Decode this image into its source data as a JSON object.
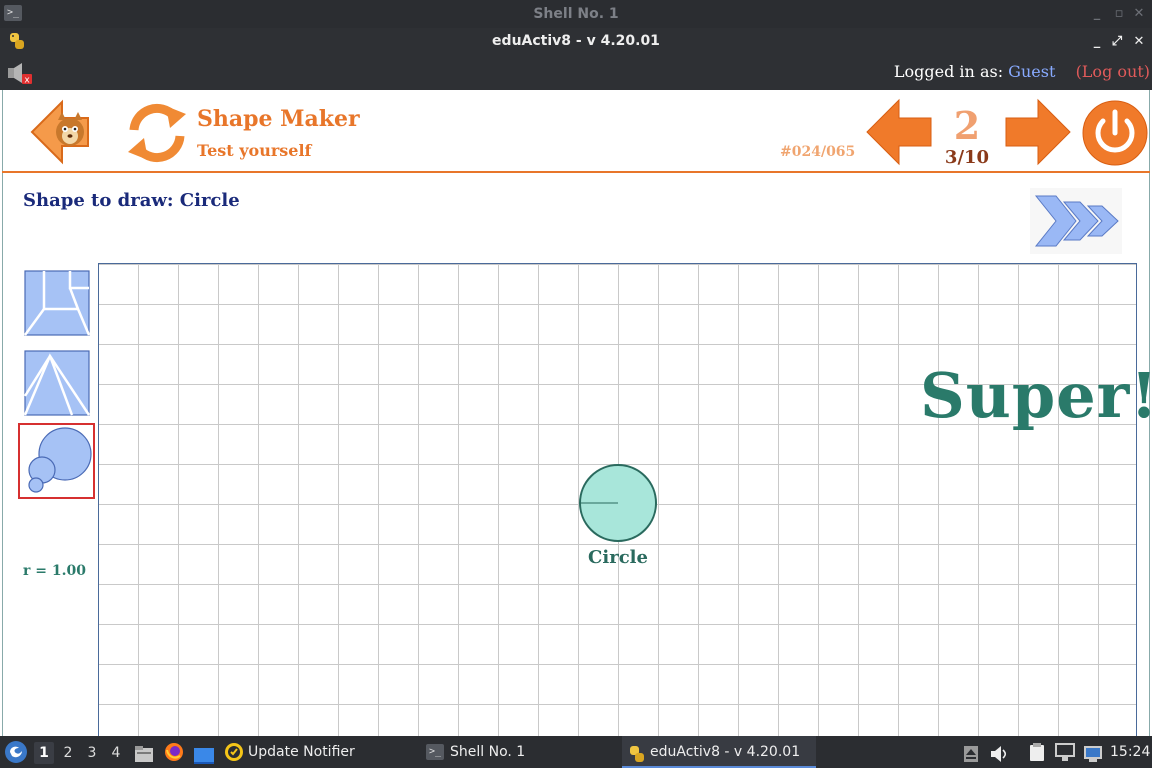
{
  "shell_window": {
    "title": "Shell No. 1"
  },
  "app_window": {
    "title": "eduActiv8 - v 4.20.01"
  },
  "login": {
    "prefix": "Logged in as:",
    "user": "Guest",
    "logout": "(Log out)"
  },
  "header": {
    "title": "Shape Maker",
    "subtitle": "Test yourself",
    "activity_id": "#024/065",
    "level": "2",
    "progress": "3/10"
  },
  "task": {
    "prompt": "Shape to draw: Circle"
  },
  "sidebar": {
    "radius_label": "r = 1.00"
  },
  "canvas": {
    "shape_label": "Circle",
    "feedback": "Super!"
  },
  "taskbar": {
    "workspaces": [
      "1",
      "2",
      "3",
      "4"
    ],
    "active_workspace": "1",
    "tasks": [
      {
        "label": "Update Notifier"
      },
      {
        "label": "Shell No. 1"
      },
      {
        "label": "eduActiv8 - v 4.20.01"
      }
    ],
    "clock": "15:24"
  },
  "colors": {
    "accent_orange": "#e8762a",
    "navy_text": "#1a2a7a",
    "teal_text": "#2a7a6a",
    "shape_fill": "#a8e6da",
    "login_user": "#88aaff",
    "logout": "#e05a5a"
  }
}
